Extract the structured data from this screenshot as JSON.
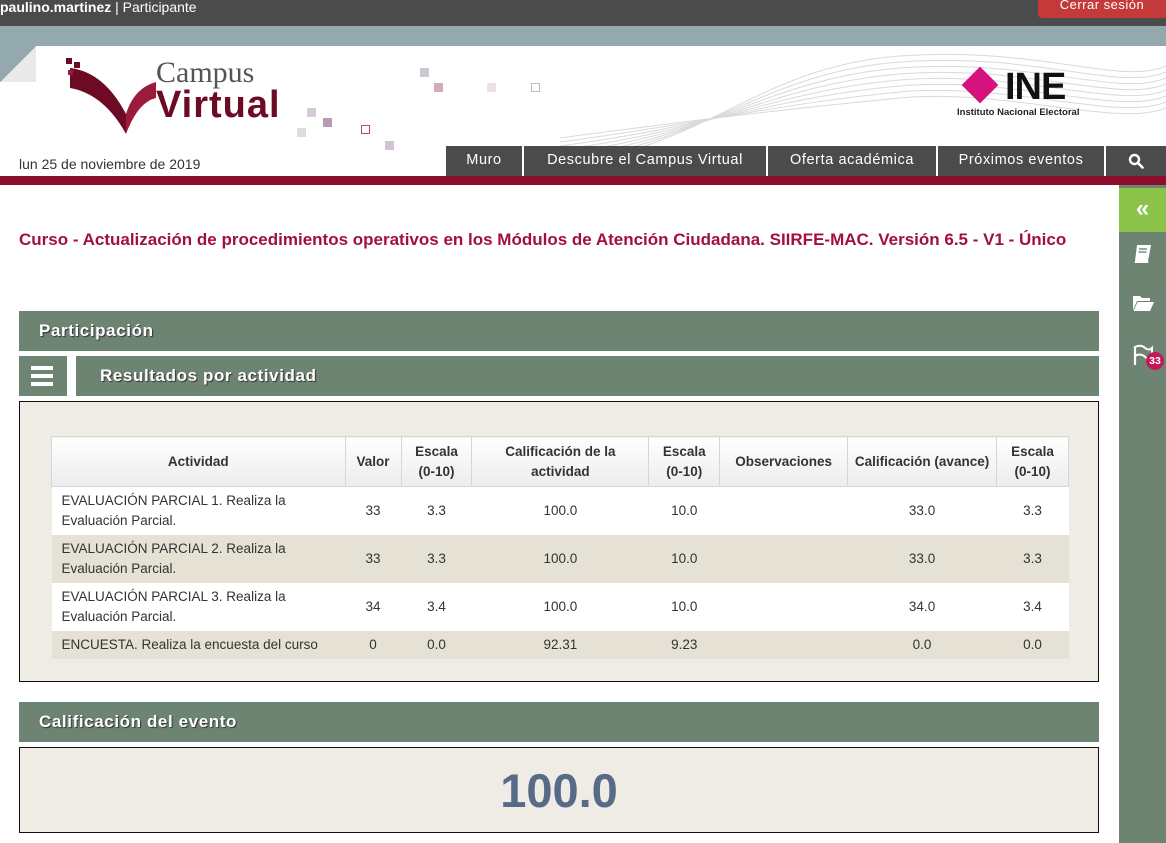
{
  "topbar": {
    "username": "paulino.martinez",
    "separator": " | ",
    "role": "Participante",
    "logout_label": "Cerrar sesión"
  },
  "header": {
    "logo_line1": "Campus",
    "logo_line2": "Virtual",
    "ine_word": "INE",
    "ine_subtitle": "Instituto Nacional Electoral",
    "date": "lun 25 de noviembre de 2019",
    "nav": [
      {
        "label": "Muro"
      },
      {
        "label": "Descubre el Campus Virtual"
      },
      {
        "label": "Oferta académica"
      },
      {
        "label": "Próximos eventos"
      }
    ]
  },
  "sidebar": {
    "collapse_glyph": "«",
    "badge_count": "33"
  },
  "course": {
    "title": "Curso - Actualización de procedimientos operativos en los Módulos de Atención Ciudadana. SIIRFE-MAC. Versión 6.5 - V1 - Único"
  },
  "sections": {
    "participation": "Participación",
    "results": "Resultados por actividad",
    "event_grade": "Calificación del evento"
  },
  "table": {
    "headers": [
      "Actividad",
      "Valor",
      "Escala (0-10)",
      "Calificación de la actividad",
      "Escala (0-10)",
      "Observaciones",
      "Calificación (avance)",
      "Escala (0-10)"
    ],
    "rows": [
      {
        "actividad": "EVALUACIÓN PARCIAL 1. Realiza la Evaluación Parcial.",
        "valor": "33",
        "escala1": "3.3",
        "calif": "100.0",
        "escala2": "10.0",
        "obs": "",
        "avance": "33.0",
        "escala3": "3.3"
      },
      {
        "actividad": "EVALUACIÓN PARCIAL 2. Realiza la Evaluación Parcial.",
        "valor": "33",
        "escala1": "3.3",
        "calif": "100.0",
        "escala2": "10.0",
        "obs": "",
        "avance": "33.0",
        "escala3": "3.3"
      },
      {
        "actividad": "EVALUACIÓN PARCIAL 3. Realiza la Evaluación Parcial.",
        "valor": "34",
        "escala1": "3.4",
        "calif": "100.0",
        "escala2": "10.0",
        "obs": "",
        "avance": "34.0",
        "escala3": "3.4"
      },
      {
        "actividad": "ENCUESTA. Realiza la encuesta del curso",
        "valor": "0",
        "escala1": "0.0",
        "calif": "92.31",
        "escala2": "9.23",
        "obs": "",
        "avance": "0.0",
        "escala3": "0.0"
      }
    ]
  },
  "final_grade": "100.0",
  "colors": {
    "topbar": "#4b4b4b",
    "logout": "#c43a3a",
    "brand_red": "#8b0f2a",
    "title_red": "#a3113a",
    "section_green": "#6d8473",
    "sidebar_active": "#8bc34a",
    "grade_blue": "#576a87",
    "ine_pink": "#d5127d"
  },
  "icons": [
    "book-icon",
    "folder-open-icon",
    "flag-icon",
    "search-icon",
    "menu-icon",
    "chevron-double-left-icon"
  ]
}
